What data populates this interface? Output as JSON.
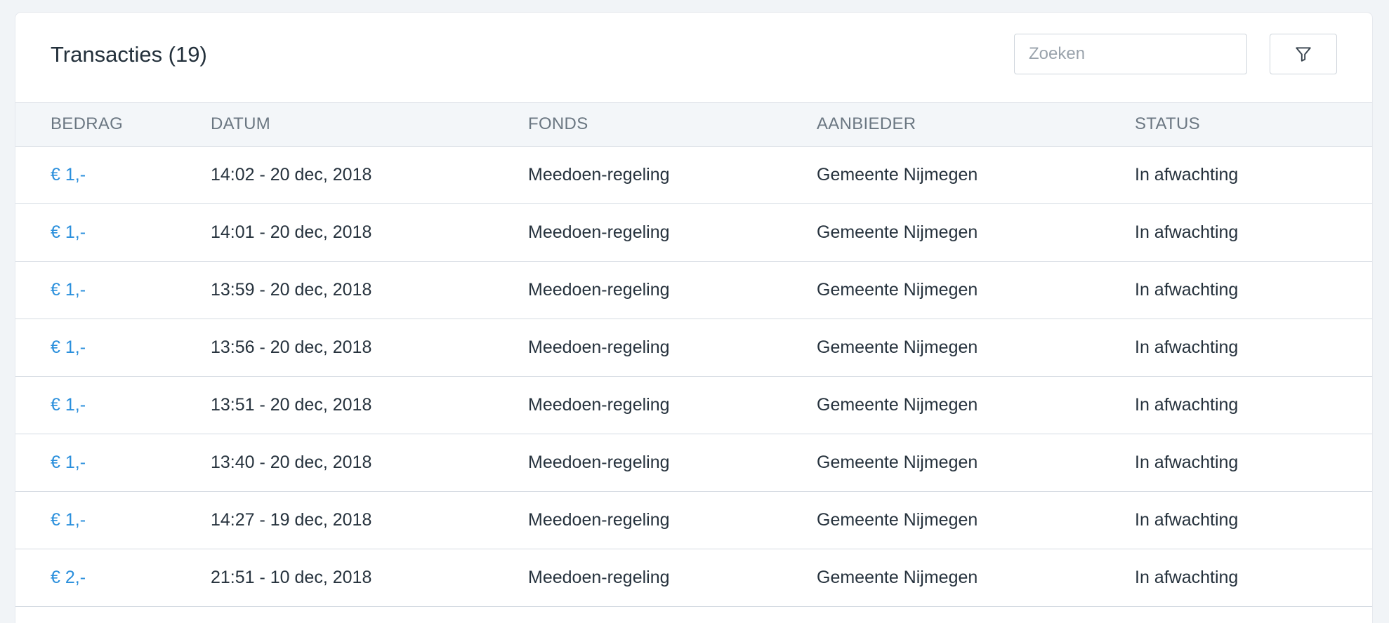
{
  "header": {
    "title": "Transacties (19)",
    "search_placeholder": "Zoeken",
    "filter_icon": "funnel-icon"
  },
  "table": {
    "columns": [
      "BEDRAG",
      "DATUM",
      "FONDS",
      "AANBIEDER",
      "STATUS"
    ],
    "rows": [
      {
        "amount": "€ 1,-",
        "date": "14:02 - 20 dec, 2018",
        "fund": "Meedoen-regeling",
        "provider": "Gemeente Nijmegen",
        "status": "In afwachting"
      },
      {
        "amount": "€ 1,-",
        "date": "14:01 - 20 dec, 2018",
        "fund": "Meedoen-regeling",
        "provider": "Gemeente Nijmegen",
        "status": "In afwachting"
      },
      {
        "amount": "€ 1,-",
        "date": "13:59 - 20 dec, 2018",
        "fund": "Meedoen-regeling",
        "provider": "Gemeente Nijmegen",
        "status": "In afwachting"
      },
      {
        "amount": "€ 1,-",
        "date": "13:56 - 20 dec, 2018",
        "fund": "Meedoen-regeling",
        "provider": "Gemeente Nijmegen",
        "status": "In afwachting"
      },
      {
        "amount": "€ 1,-",
        "date": "13:51 - 20 dec, 2018",
        "fund": "Meedoen-regeling",
        "provider": "Gemeente Nijmegen",
        "status": "In afwachting"
      },
      {
        "amount": "€ 1,-",
        "date": "13:40 - 20 dec, 2018",
        "fund": "Meedoen-regeling",
        "provider": "Gemeente Nijmegen",
        "status": "In afwachting"
      },
      {
        "amount": "€ 1,-",
        "date": "14:27 - 19 dec, 2018",
        "fund": "Meedoen-regeling",
        "provider": "Gemeente Nijmegen",
        "status": "In afwachting"
      },
      {
        "amount": "€ 2,-",
        "date": "21:51 - 10 dec, 2018",
        "fund": "Meedoen-regeling",
        "provider": "Gemeente Nijmegen",
        "status": "In afwachting"
      }
    ]
  },
  "colors": {
    "link": "#2a8fdc",
    "header_bg": "#f3f6f9",
    "page_bg": "#f1f4f7"
  }
}
